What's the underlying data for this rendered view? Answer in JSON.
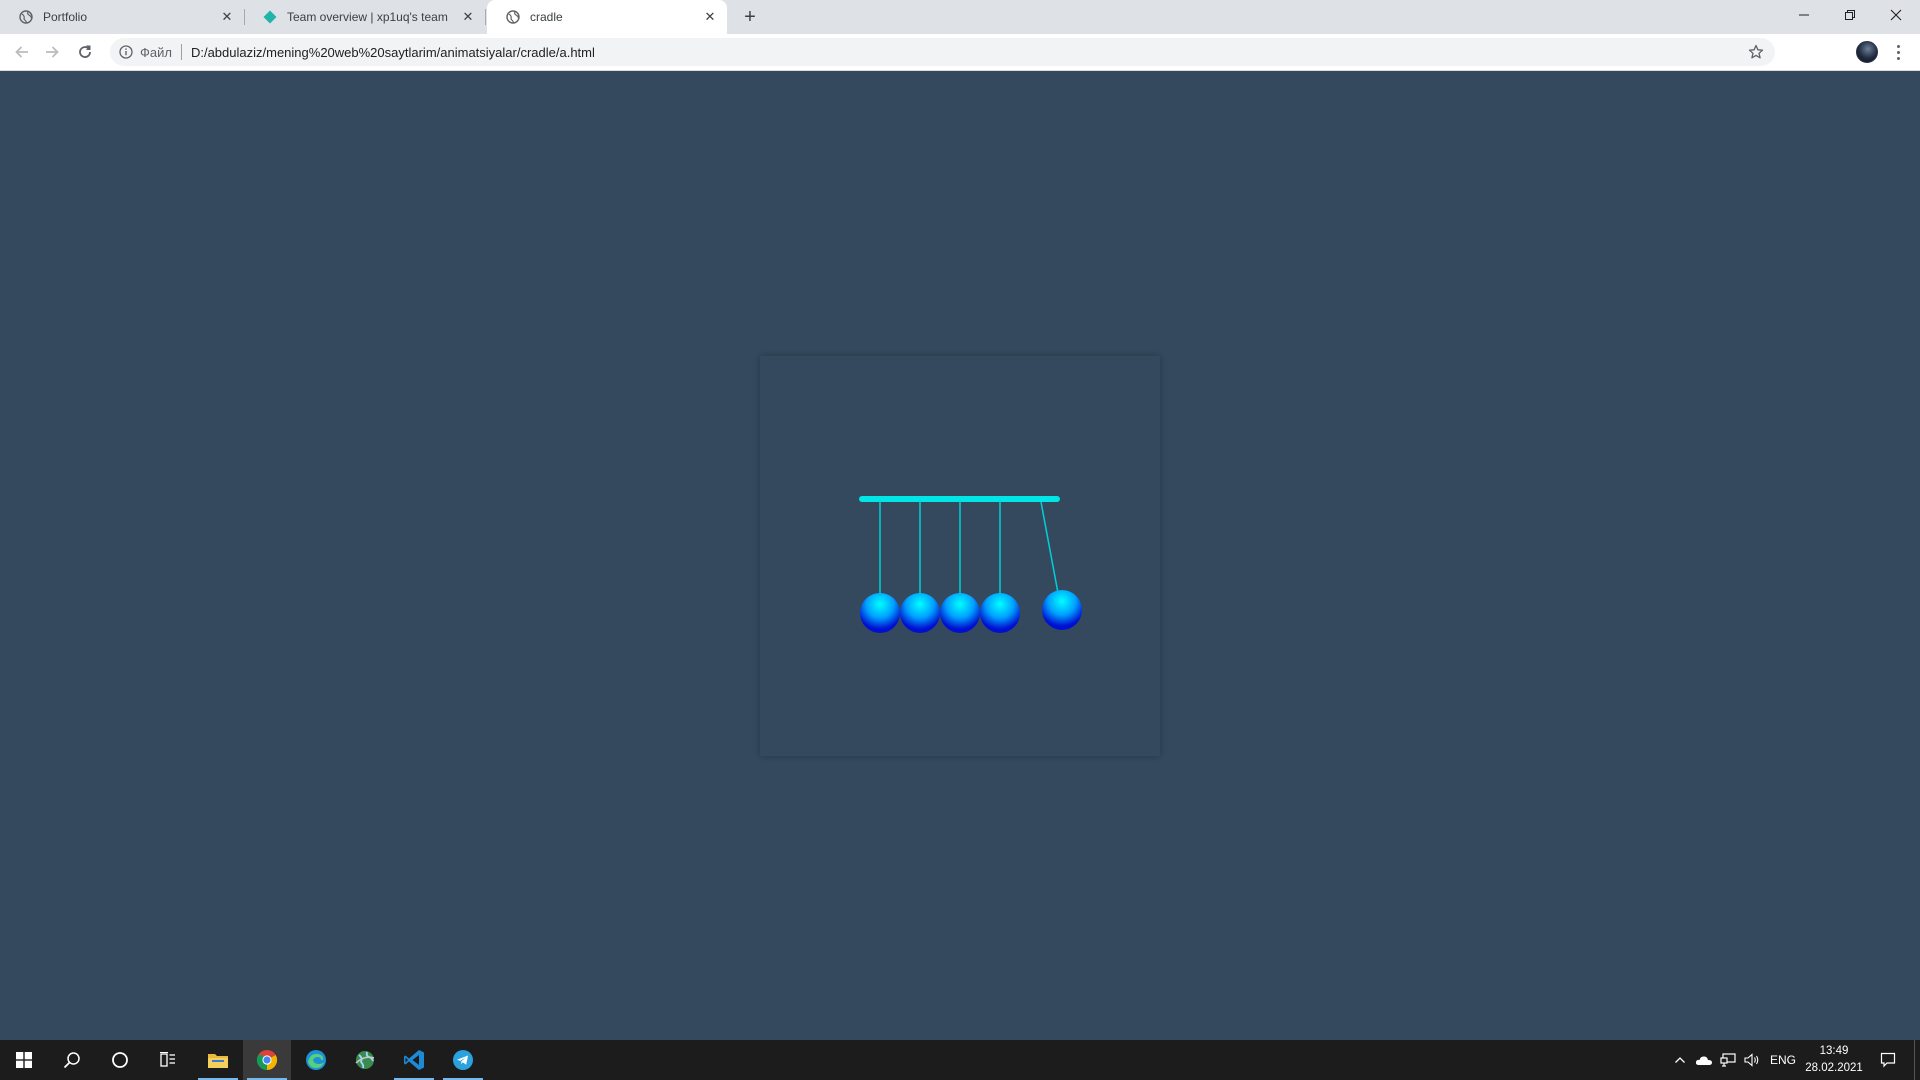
{
  "browser": {
    "tabs": [
      {
        "title": "Portfolio",
        "icon": "globe-icon",
        "active": false
      },
      {
        "title": "Team overview | xp1uq's team",
        "icon": "netlify-icon",
        "active": false
      },
      {
        "title": "cradle",
        "icon": "globe-icon",
        "active": true
      }
    ],
    "new_tab_icon": "plus-icon",
    "window_controls": [
      "minimize-icon",
      "restore-icon",
      "close-icon"
    ],
    "omnibox": {
      "chip_label": "Файл",
      "url": "D:/abdulaziz/mening%20web%20saytlarim/animatsiyalar/cradle/a.html"
    }
  },
  "page": {
    "background_color": "#34495e",
    "cradle": {
      "bar_color": "#00e6e6",
      "string_color": "#00d0d8",
      "ball_colors": [
        "#00ffff",
        "#00a0ff",
        "#0010d0"
      ],
      "ball_count": 5
    }
  },
  "taskbar": {
    "apps": [
      {
        "name": "start-button",
        "icon": "windows-icon"
      },
      {
        "name": "search-button",
        "icon": "search-icon"
      },
      {
        "name": "cortana-button",
        "icon": "cortana-icon"
      },
      {
        "name": "task-view-button",
        "icon": "task-view-icon"
      },
      {
        "name": "file-explorer",
        "icon": "folder-icon"
      },
      {
        "name": "chrome",
        "icon": "chrome-icon"
      },
      {
        "name": "edge",
        "icon": "edge-icon"
      },
      {
        "name": "globe-app",
        "icon": "globe-app-icon"
      },
      {
        "name": "vscode",
        "icon": "vscode-icon"
      },
      {
        "name": "telegram",
        "icon": "telegram-icon"
      }
    ],
    "tray": {
      "language": "ENG",
      "time": "13:49",
      "date": "28.02.2021"
    }
  }
}
